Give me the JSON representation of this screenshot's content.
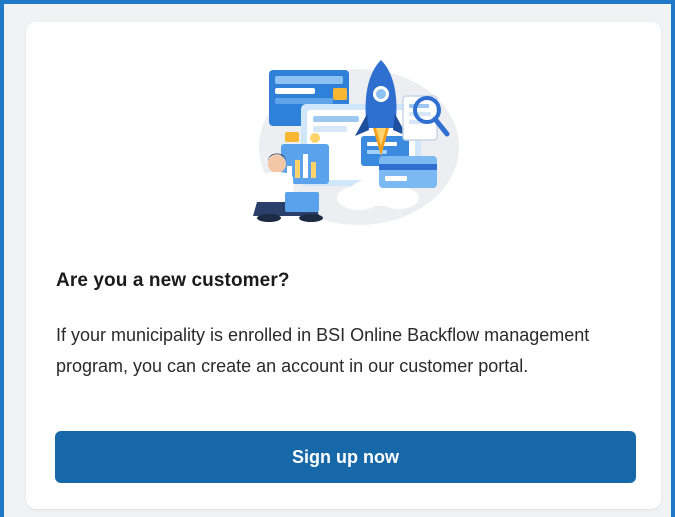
{
  "card": {
    "illustration_icon": "rocket-launch-illustration",
    "heading": "Are you a new customer?",
    "body": "If your municipality is enrolled in BSI Online Backflow management program, you can create an account in our customer portal.",
    "signup_label": "Sign up now"
  },
  "colors": {
    "frame_border": "#1f78c8",
    "button": "#1768a8",
    "button_text": "#ffffff",
    "page_background": "#f1f2f4",
    "card_background": "#ffffff"
  }
}
